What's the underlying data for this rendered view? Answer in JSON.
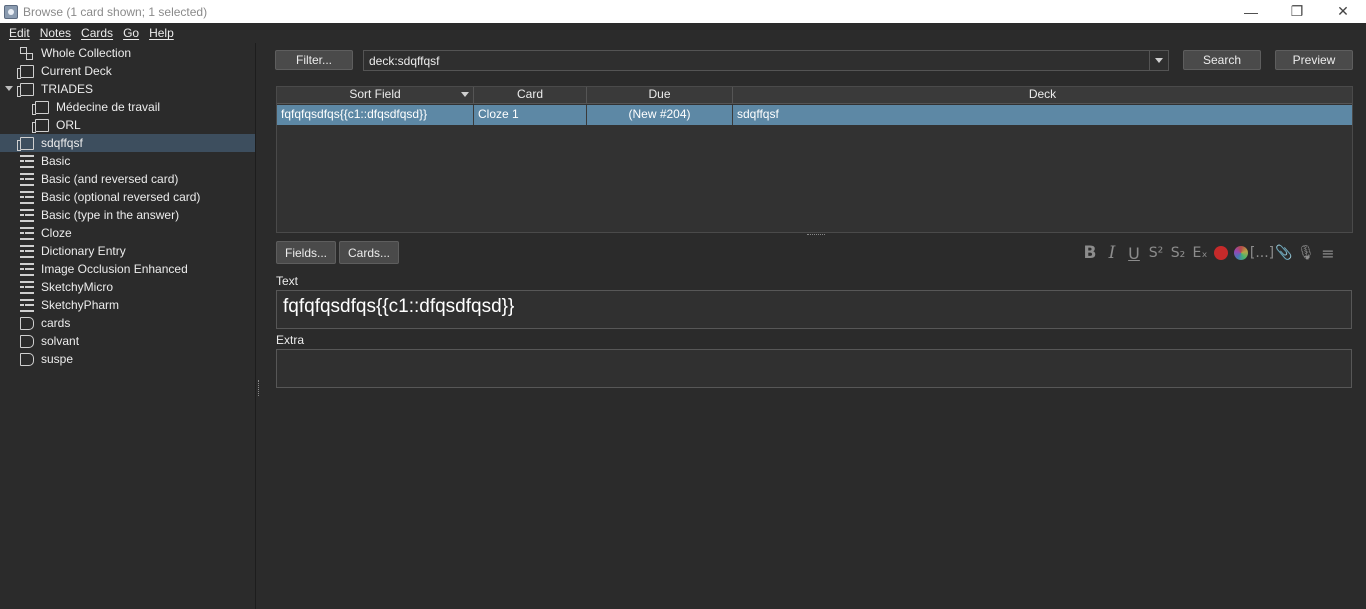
{
  "window": {
    "title": "Browse (1 card shown; 1 selected)",
    "controls": {
      "minimize": "—",
      "restore": "❐",
      "close": "✕"
    }
  },
  "menu": [
    "Edit",
    "Notes",
    "Cards",
    "Go",
    "Help"
  ],
  "sidebar": {
    "items": [
      {
        "label": "Whole Collection",
        "icon": "collection-icon"
      },
      {
        "label": "Current Deck",
        "icon": "deck-icon"
      },
      {
        "label": "TRIADES",
        "icon": "deck-icon",
        "expanded": true
      },
      {
        "label": "Médecine de travail",
        "icon": "deck-icon"
      },
      {
        "label": "ORL",
        "icon": "deck-icon"
      },
      {
        "label": "sdqffqsf",
        "icon": "deck-icon",
        "selected": true
      },
      {
        "label": "Basic",
        "icon": "notetype-icon"
      },
      {
        "label": "Basic (and reversed card)",
        "icon": "notetype-icon"
      },
      {
        "label": "Basic (optional reversed card)",
        "icon": "notetype-icon"
      },
      {
        "label": "Basic (type in the answer)",
        "icon": "notetype-icon"
      },
      {
        "label": "Cloze",
        "icon": "notetype-icon"
      },
      {
        "label": "Dictionary Entry",
        "icon": "notetype-icon"
      },
      {
        "label": "Image Occlusion Enhanced",
        "icon": "notetype-icon"
      },
      {
        "label": "SketchyMicro",
        "icon": "notetype-icon"
      },
      {
        "label": "SketchyPharm",
        "icon": "notetype-icon"
      },
      {
        "label": "cards",
        "icon": "tag-icon"
      },
      {
        "label": "solvant",
        "icon": "tag-icon"
      },
      {
        "label": "suspe",
        "icon": "tag-icon"
      }
    ]
  },
  "toolbar": {
    "filter_label": "Filter...",
    "search_value": "deck:sdqffqsf",
    "search_label": "Search",
    "preview_label": "Preview"
  },
  "table": {
    "columns": [
      "Sort Field",
      "Card",
      "Due",
      "Deck"
    ],
    "rows": [
      {
        "sort_field": "fqfqfqsdfqs{{c1::dfqsdfqsd}}",
        "card": "Cloze 1",
        "due": "(New #204)",
        "deck": "sdqffqsf"
      }
    ]
  },
  "editor": {
    "fields_label": "Fields...",
    "cards_label": "Cards...",
    "format_buttons": {
      "bold": "B",
      "italic": "I",
      "underline": "U",
      "superscript": "S²",
      "subscript": "S₂",
      "clear": "Eₓ",
      "cloze": "[...]",
      "attach": "📎",
      "record": "🎙",
      "more": "≡"
    },
    "fields": [
      {
        "name": "Text",
        "value": "fqfqfqsdfqs{{c1::dfqsdfqsd}}"
      },
      {
        "name": "Extra",
        "value": ""
      }
    ]
  },
  "colors": {
    "selection": "#5d88a5",
    "sidebar_selected": "#3d4e5e",
    "text_color_button": "#c62a2a"
  }
}
